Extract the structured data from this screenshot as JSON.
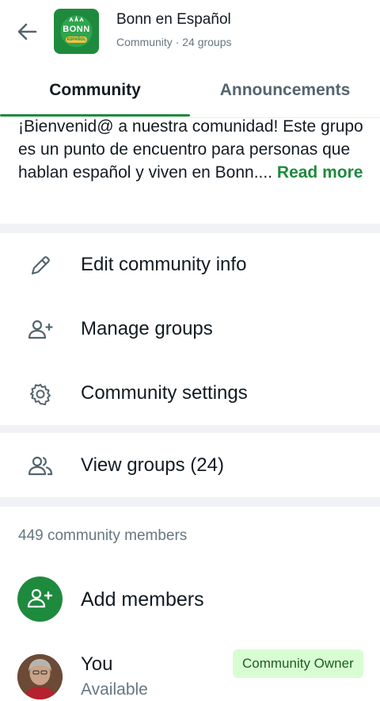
{
  "header": {
    "back_icon": "arrow-left-icon",
    "logo_line1": "BONN",
    "logo_line2": "ESPAÑOL",
    "title": "Bonn en Español",
    "subtitle": "Community · 24 groups"
  },
  "tabs": [
    {
      "label": "Community",
      "active": true
    },
    {
      "label": "Announcements",
      "active": false
    }
  ],
  "description": {
    "text": "¡Bienvenid@ a nuestra comunidad! Este grupo es un punto de encuentro para personas que hablan español y viven en Bonn....",
    "read_more": "Read more"
  },
  "actions": [
    {
      "label": "Edit community info",
      "icon": "pencil-icon"
    },
    {
      "label": "Manage groups",
      "icon": "manage-groups-icon"
    },
    {
      "label": "Community settings",
      "icon": "gear-icon"
    }
  ],
  "view_groups": {
    "label": "View groups (24)",
    "icon": "groups-icon"
  },
  "members": {
    "count_label": "449 community members",
    "add_label": "Add members",
    "add_icon": "add-person-icon",
    "self": {
      "name": "You",
      "status": "Available",
      "role_badge": "Community Owner"
    }
  },
  "colors": {
    "accent": "#1e8a3e",
    "badge_bg": "#d9fdd3",
    "separator": "#f0f2f5"
  }
}
